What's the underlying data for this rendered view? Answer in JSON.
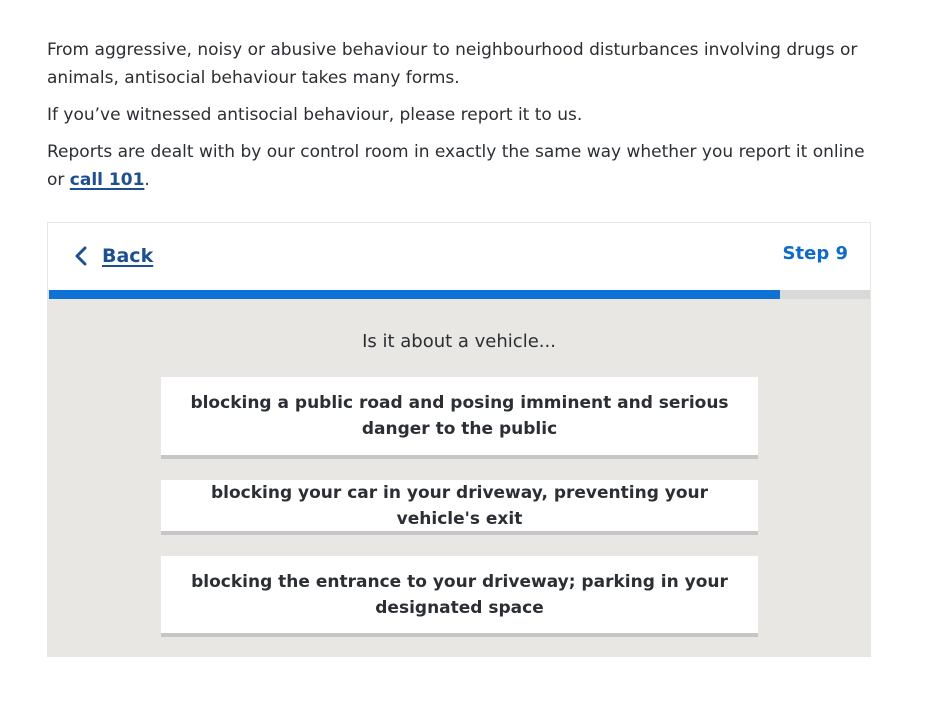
{
  "intro": {
    "paragraph1": "From aggressive, noisy or abusive behaviour to neighbourhood disturbances involving drugs or animals, antisocial behaviour takes many forms.",
    "paragraph2": "If you’ve witnessed antisocial behaviour, please report it to us.",
    "paragraph3_before": "Reports are dealt with by our control room in exactly the same way whether you report it online or ",
    "paragraph3_link": "call 101",
    "paragraph3_after": "."
  },
  "widget": {
    "back_label": "Back",
    "step_label": "Step 9",
    "progress_fraction": 0.89,
    "question": "Is it about a vehicle...",
    "options": [
      "blocking a public road and posing imminent and serious danger to the public",
      "blocking your car in your driveway, preventing your vehicle's exit",
      "blocking the entrance to your driveway; parking in your designated space"
    ]
  },
  "colors": {
    "link": "#1d4f91",
    "accent": "#1071d4",
    "step": "#0f6bc5",
    "panel_bg": "#e8e7e4"
  },
  "icons": {
    "back": "chevron-left-icon"
  }
}
